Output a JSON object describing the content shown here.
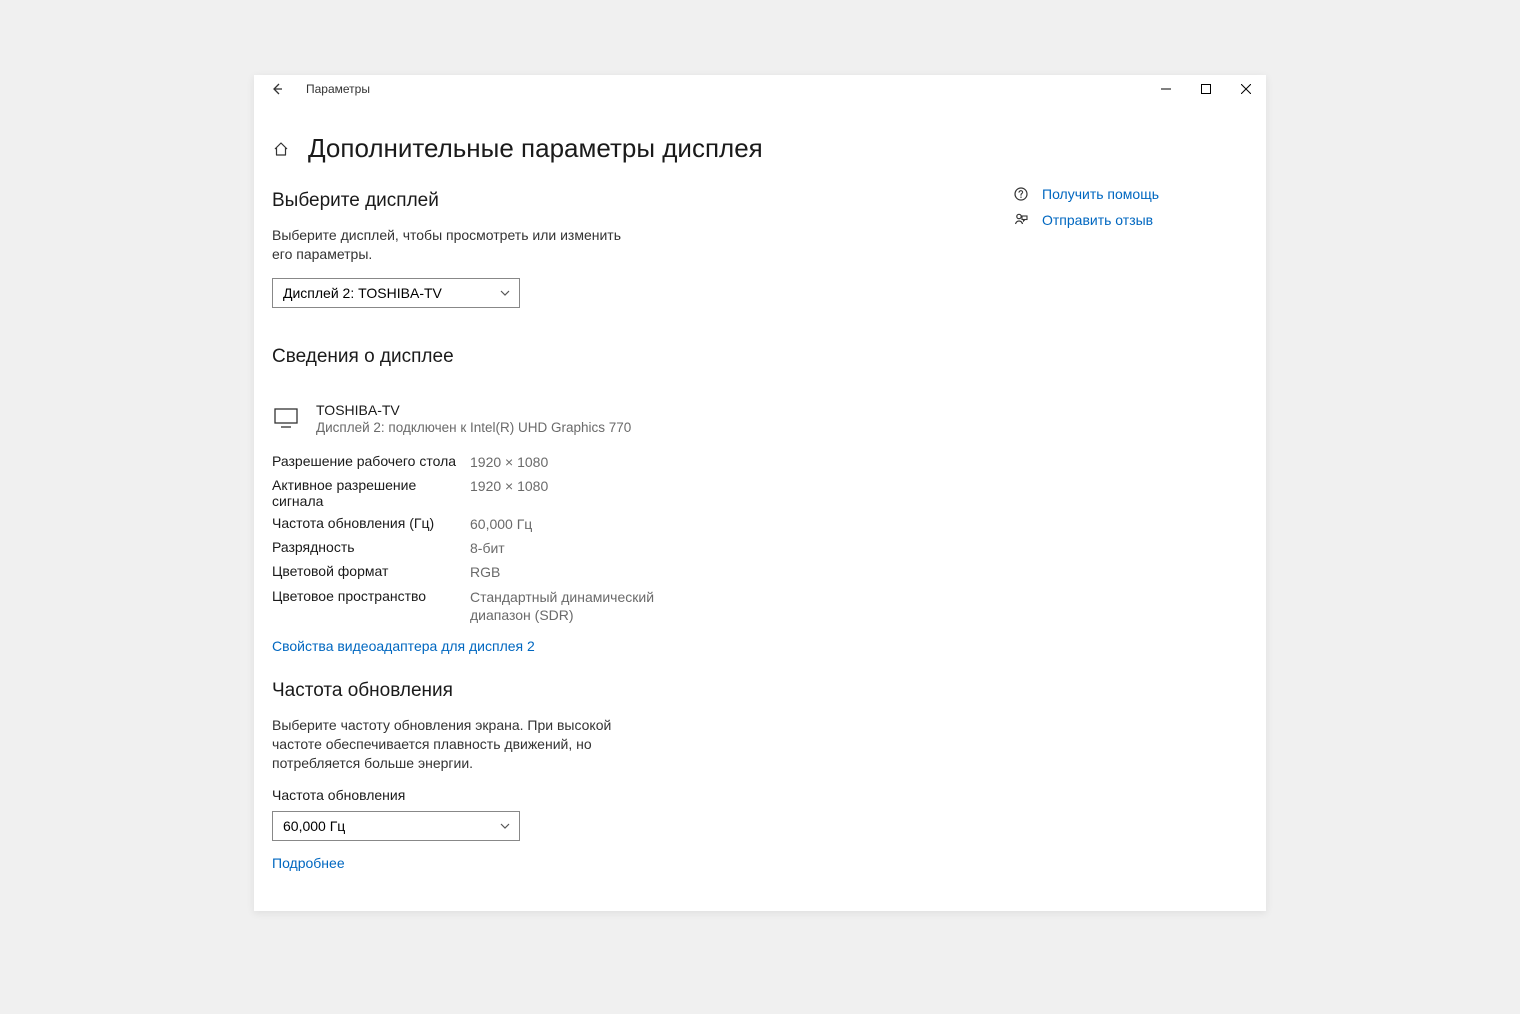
{
  "titlebar": {
    "title": "Параметры"
  },
  "page": {
    "title": "Дополнительные параметры дисплея"
  },
  "select_display": {
    "heading": "Выберите дисплей",
    "text": "Выберите дисплей, чтобы просмотреть или изменить его параметры.",
    "selected": "Дисплей 2: TOSHIBA-TV"
  },
  "display_info": {
    "heading": "Сведения о дисплее",
    "name": "TOSHIBA-TV",
    "sub": "Дисплей 2: подключен к Intel(R) UHD Graphics 770",
    "rows": [
      {
        "label": "Разрешение рабочего стола",
        "value": "1920 × 1080"
      },
      {
        "label": "Активное разрешение сигнала",
        "value": "1920 × 1080"
      },
      {
        "label": "Частота обновления (Гц)",
        "value": "60,000 Гц"
      },
      {
        "label": "Разрядность",
        "value": "8-бит"
      },
      {
        "label": "Цветовой формат",
        "value": "RGB"
      },
      {
        "label": "Цветовое пространство",
        "value": "Стандартный динамический диапазон (SDR)"
      }
    ],
    "adapter_link": "Свойства видеоадаптера для дисплея 2"
  },
  "refresh": {
    "heading": "Частота обновления",
    "text": "Выберите частоту обновления экрана. При высокой частоте обеспечивается плавность движений, но потребляется больше энергии.",
    "label": "Частота обновления",
    "selected": "60,000 Гц",
    "more_link": "Подробнее"
  },
  "side": {
    "help": "Получить помощь",
    "feedback": "Отправить отзыв"
  }
}
